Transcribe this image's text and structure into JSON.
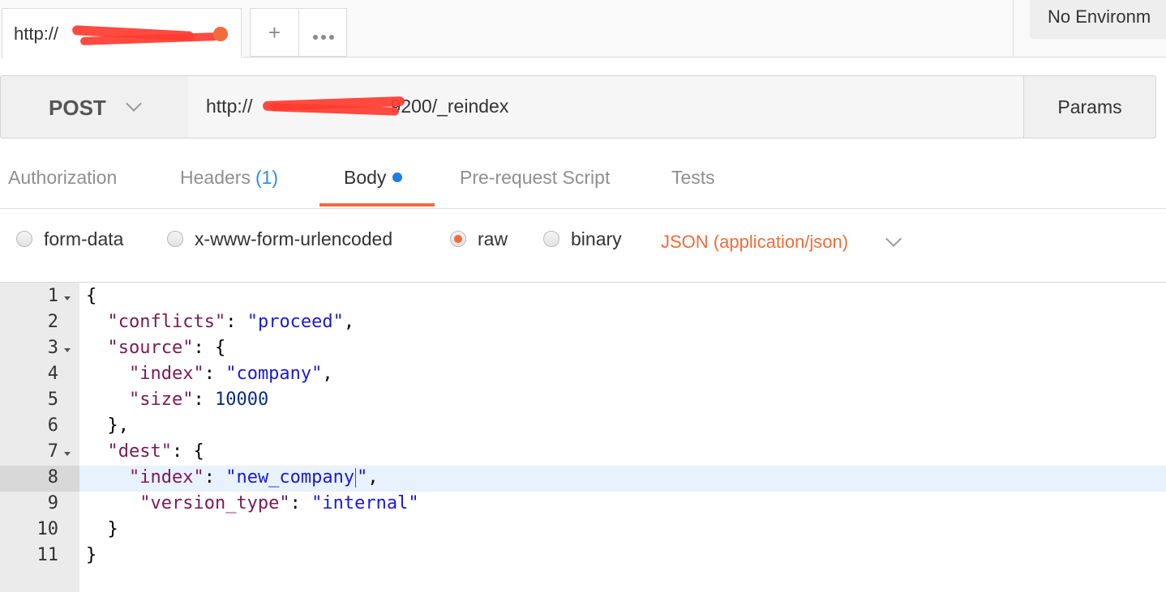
{
  "tab_bar": {
    "active_tab_label": "http://",
    "new_tab_label": "+",
    "environment_label": "No Environm"
  },
  "request": {
    "method": "POST",
    "url_prefix": "http://",
    "url_suffix": "9200/_reindex",
    "params_label": "Params"
  },
  "request_tabs": {
    "authorization": "Authorization",
    "headers": "Headers",
    "headers_count": "(1)",
    "body": "Body",
    "pre_request_script": "Pre-request Script",
    "tests": "Tests"
  },
  "body_types": {
    "options": [
      "form-data",
      "x-www-form-urlencoded",
      "raw",
      "binary"
    ],
    "selected": "raw",
    "content_type": "JSON (application/json)"
  },
  "editor": {
    "line_numbers": [
      "1",
      "2",
      "3",
      "4",
      "5",
      "6",
      "7",
      "8",
      "9",
      "10",
      "11"
    ],
    "active_line": "8",
    "code": {
      "l1": "{",
      "l2_key": "\"conflicts\"",
      "l2_val": "\"proceed\"",
      "l3_key": "\"source\"",
      "l4_key": "\"index\"",
      "l4_val": "\"company\"",
      "l5_key": "\"size\"",
      "l5_val": "10000",
      "l6": "},",
      "l7_key": "\"dest\"",
      "l8_key": "\"index\"",
      "l8_val_a": "\"new_company",
      "l8_val_b": "\"",
      "l9_key": "\"version_type\"",
      "l9_val": "\"internal\"",
      "l10": "}",
      "l11": "}"
    }
  },
  "colors": {
    "accent_orange": "#f26b3a",
    "badge_blue": "#1e7de6",
    "json_key": "#7a1a54",
    "json_string": "#1a1ad6",
    "json_number": "#0b2a8c"
  }
}
